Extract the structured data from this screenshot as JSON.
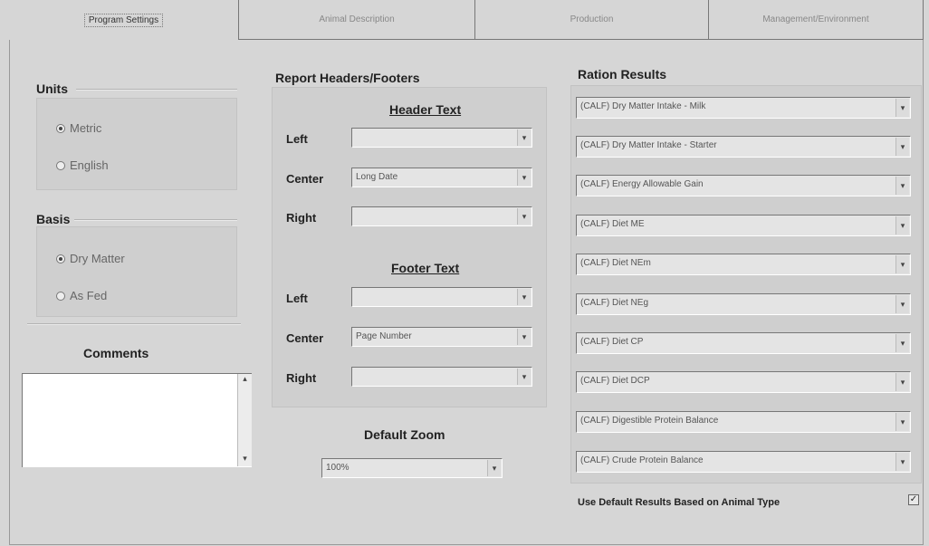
{
  "tabs": [
    {
      "label": "Program Settings",
      "active": true
    },
    {
      "label": "Animal Description",
      "active": false
    },
    {
      "label": "Production",
      "active": false
    },
    {
      "label": "Management/Environment",
      "active": false
    }
  ],
  "units": {
    "title": "Units",
    "options": [
      {
        "label": "Metric",
        "selected": true
      },
      {
        "label": "English",
        "selected": false
      }
    ]
  },
  "basis": {
    "title": "Basis",
    "options": [
      {
        "label": "Dry Matter",
        "selected": true
      },
      {
        "label": "As Fed",
        "selected": false
      }
    ]
  },
  "comments": {
    "title": "Comments",
    "value": ""
  },
  "report": {
    "title": "Report Headers/Footers",
    "header": {
      "title": "Header Text",
      "left_label": "Left",
      "left_value": "",
      "center_label": "Center",
      "center_value": "Long Date",
      "right_label": "Right",
      "right_value": ""
    },
    "footer": {
      "title": "Footer Text",
      "left_label": "Left",
      "left_value": "",
      "center_label": "Center",
      "center_value": "Page Number",
      "right_label": "Right",
      "right_value": ""
    }
  },
  "zoom": {
    "title": "Default Zoom",
    "value": "100%"
  },
  "ration": {
    "title": "Ration Results",
    "items": [
      "(CALF) Dry Matter Intake - Milk",
      "(CALF) Dry Matter Intake - Starter",
      "(CALF) Energy Allowable Gain",
      "(CALF) Diet ME",
      "(CALF) Diet NEm",
      "(CALF) Diet NEg",
      "(CALF) Diet CP",
      "(CALF) Diet DCP",
      "(CALF) Digestible Protein Balance",
      "(CALF) Crude Protein Balance"
    ],
    "default_label": "Use Default Results Based on Animal Type",
    "default_checked": true,
    "check_mark": "✓"
  },
  "glyphs": {
    "dropdown": "▾",
    "scroll_up": "▴",
    "scroll_down": "▾"
  }
}
